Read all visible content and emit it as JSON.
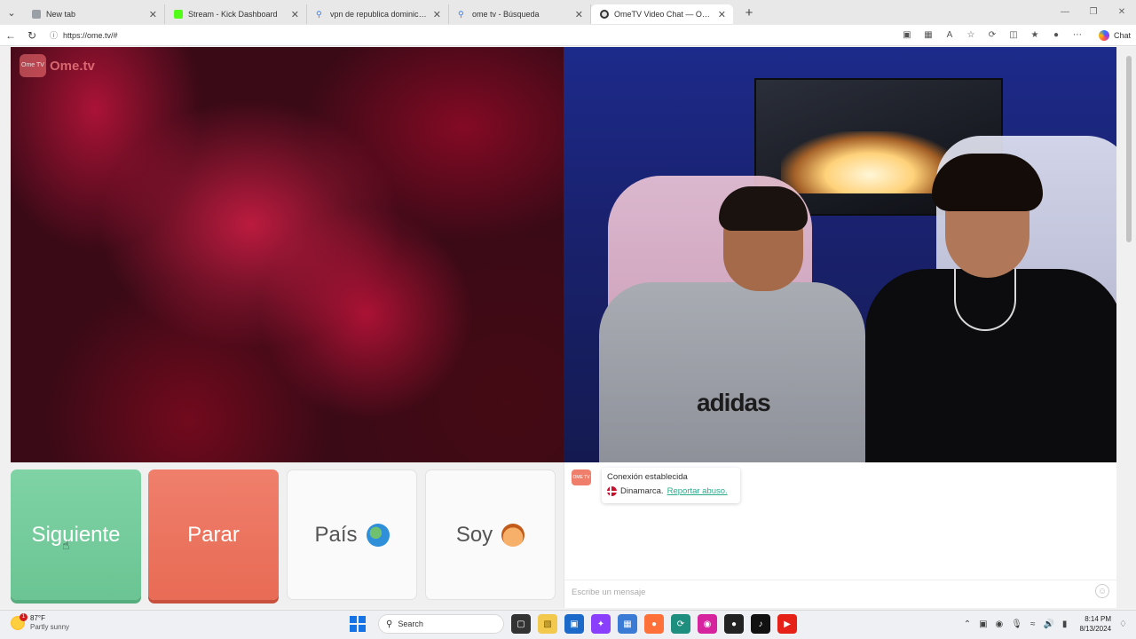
{
  "browser": {
    "tabs": [
      {
        "title": "New tab",
        "favicon_color": "#9aa0a6",
        "active": false
      },
      {
        "title": "Stream - Kick Dashboard",
        "favicon_color": "#53fc18",
        "active": false
      },
      {
        "title": "vpn de republica dominicana extensión",
        "favicon_color": "#2f7cf6",
        "active": false
      },
      {
        "title": "ome tv - Búsqueda",
        "favicon_color": "#2f7cf6",
        "active": false
      },
      {
        "title": "OmeTV Video Chat — Omegle",
        "favicon_color": "#333333",
        "active": true
      }
    ],
    "new_tab_label": "+",
    "url": "https://ome.tv/#",
    "chat_label": "Chat"
  },
  "app": {
    "logo_box_text": "Ome TV",
    "logo_text": "Ome.tv"
  },
  "buttons": {
    "next_label": "Siguiente",
    "stop_label": "Parar",
    "country_label": "País",
    "gender_label": "Soy"
  },
  "remote_video": {
    "shirt_print": "adidas"
  },
  "chat": {
    "messages": [
      {
        "line1": "Conexión establecida",
        "country": "Dinamarca.",
        "report_link": "Reportar abuso."
      }
    ],
    "input_placeholder": "Escribe un mensaje"
  },
  "taskbar": {
    "weather_temp": "87°F",
    "weather_desc": "Partly sunny",
    "weather_badge": "1",
    "search_label": "Search",
    "time": "8:14 PM",
    "date": "8/13/2024"
  },
  "colors": {
    "next_green": "#7fd3a5",
    "stop_red": "#ef7f6b",
    "report_link": "#2bab8c"
  }
}
